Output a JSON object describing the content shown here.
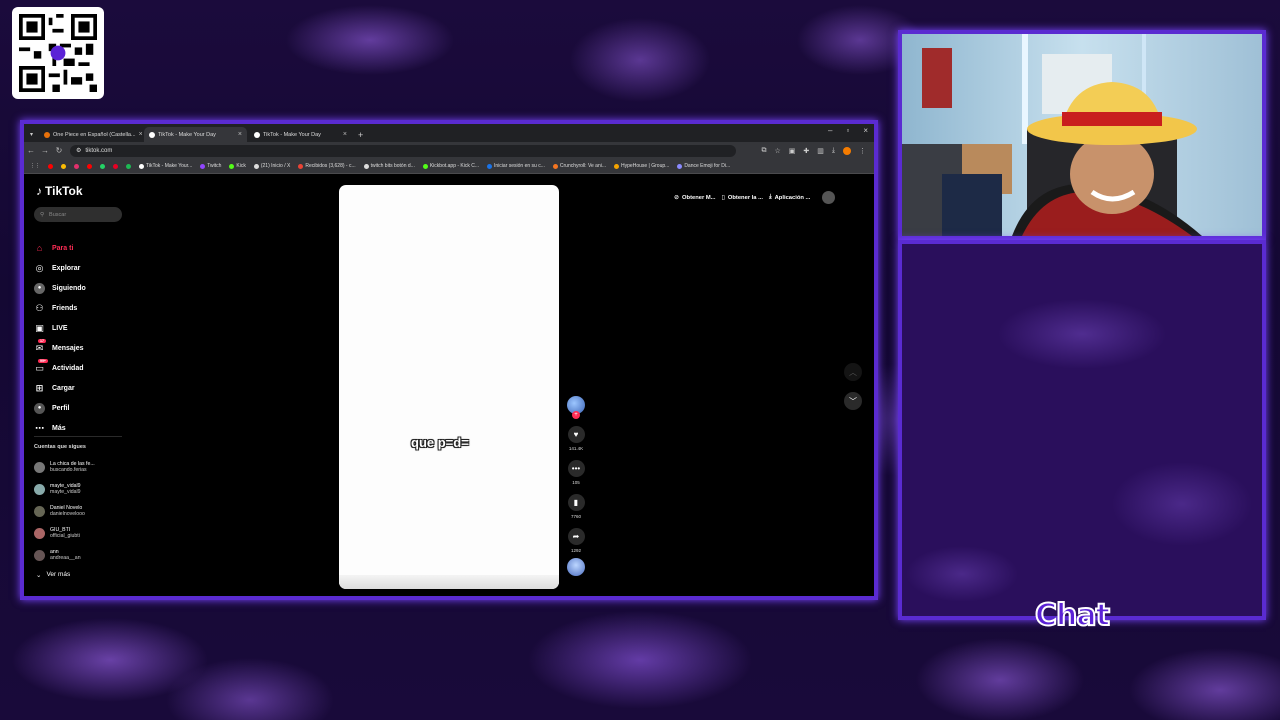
{
  "browser": {
    "tabs": [
      {
        "title": "One Piece en Español (Castella...",
        "fav_color": "#e8710a"
      },
      {
        "title": "TikTok - Make Your Day",
        "fav_color": "#ffffff"
      },
      {
        "title": "TikTok - Make Your Day",
        "fav_color": "#ffffff"
      }
    ],
    "url": "tiktok.com",
    "bookmarks": [
      {
        "label": "TikTok - Make Your...",
        "color": "#ffffff"
      },
      {
        "label": "Twitch",
        "color": "#9146ff"
      },
      {
        "label": "Kick",
        "color": "#53fc18"
      },
      {
        "label": "(21) Inicio / X",
        "color": "#dddddd"
      },
      {
        "label": "Recibidos (3,628) - c...",
        "color": "#ea4335"
      },
      {
        "label": "twitch bits botón d...",
        "color": "#dddddd"
      },
      {
        "label": "Kickbot.app - Kick C...",
        "color": "#53fc18"
      },
      {
        "label": "Iniciar sesión en su c...",
        "color": "#1a73e8"
      },
      {
        "label": "Crunchyroll: Ve ani...",
        "color": "#f47521"
      },
      {
        "label": "HypeHouse | Group...",
        "color": "#f4a300"
      },
      {
        "label": "Dance Emoji for Di...",
        "color": "#8a8aff"
      }
    ]
  },
  "tiktok": {
    "logo": "TikTok",
    "search_placeholder": "Buscar",
    "nav": [
      {
        "label": "Para ti",
        "icon": "home-icon",
        "active": true
      },
      {
        "label": "Explorar",
        "icon": "compass-icon"
      },
      {
        "label": "Siguiendo",
        "icon": "following-icon"
      },
      {
        "label": "Friends",
        "icon": "friends-icon"
      },
      {
        "label": "LIVE",
        "icon": "live-icon"
      },
      {
        "label": "Mensajes",
        "icon": "messages-icon",
        "badge": "17"
      },
      {
        "label": "Actividad",
        "icon": "activity-icon",
        "badge": "99+"
      },
      {
        "label": "Cargar",
        "icon": "upload-icon"
      },
      {
        "label": "Perfil",
        "icon": "profile-icon"
      },
      {
        "label": "Más",
        "icon": "more-icon"
      }
    ],
    "following_title": "Cuentas que sigues",
    "following": [
      {
        "name": "La chica de las fe...",
        "handle": "buscando.ferias"
      },
      {
        "name": "mayte_vidal9",
        "handle": "mayte_vidal9"
      },
      {
        "name": "Daniel Novelo",
        "handle": "danielnovelooo"
      },
      {
        "name": "GIU_BTI",
        "handle": "official_giubti"
      },
      {
        "name": "ann",
        "handle": "andreaa__an"
      }
    ],
    "see_more": "Ver más",
    "top_buttons": [
      "Obtener M...",
      "Obtener la ...",
      "Aplicación ..."
    ],
    "caption": "que p=d=",
    "actions": {
      "likes": "141.4K",
      "comments": "105",
      "saves": "7760",
      "shares": "1292"
    }
  },
  "overlay": {
    "chat_label": "Chat"
  }
}
